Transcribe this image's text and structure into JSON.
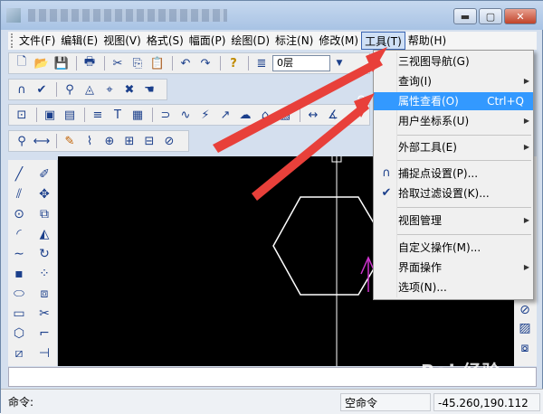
{
  "window": {
    "min_label": "▬",
    "max_label": "▢",
    "close_label": "✕"
  },
  "menubar": {
    "items": [
      {
        "label": "文件(F)"
      },
      {
        "label": "编辑(E)"
      },
      {
        "label": "视图(V)"
      },
      {
        "label": "格式(S)"
      },
      {
        "label": "幅面(P)"
      },
      {
        "label": "绘图(D)"
      },
      {
        "label": "标注(N)"
      },
      {
        "label": "修改(M)"
      },
      {
        "label": "工具(T)"
      },
      {
        "label": "帮助(H)"
      }
    ]
  },
  "toolbar": {
    "layer_value": "0层"
  },
  "tools_menu": {
    "items": [
      {
        "label": "三视图导航(G)",
        "shortcut": "",
        "submenu": false
      },
      {
        "label": "查询(I)",
        "shortcut": "",
        "submenu": true
      },
      {
        "label": "属性查看(O)",
        "shortcut": "Ctrl+Q",
        "submenu": false
      },
      {
        "label": "用户坐标系(U)",
        "shortcut": "",
        "submenu": true
      },
      {
        "label": "外部工具(E)",
        "shortcut": "",
        "submenu": true
      },
      {
        "label": "捕捉点设置(P)...",
        "shortcut": "",
        "submenu": false
      },
      {
        "label": "拾取过滤设置(K)...",
        "shortcut": "",
        "submenu": false
      },
      {
        "label": "视图管理",
        "shortcut": "",
        "submenu": true
      },
      {
        "label": "自定义操作(M)...",
        "shortcut": "",
        "submenu": false
      },
      {
        "label": "界面操作",
        "shortcut": "",
        "submenu": true
      },
      {
        "label": "选项(N)...",
        "shortcut": "",
        "submenu": false
      }
    ]
  },
  "status": {
    "command_label": "命令:",
    "mode_text": "空命令",
    "coordinates": "-45.260,190.112"
  },
  "watermark": "Bai 经验",
  "colors": {
    "highlight": "#3399ff",
    "arrow": "#e8403a",
    "shape": "#ffffff",
    "marker": "#cc33cc"
  }
}
